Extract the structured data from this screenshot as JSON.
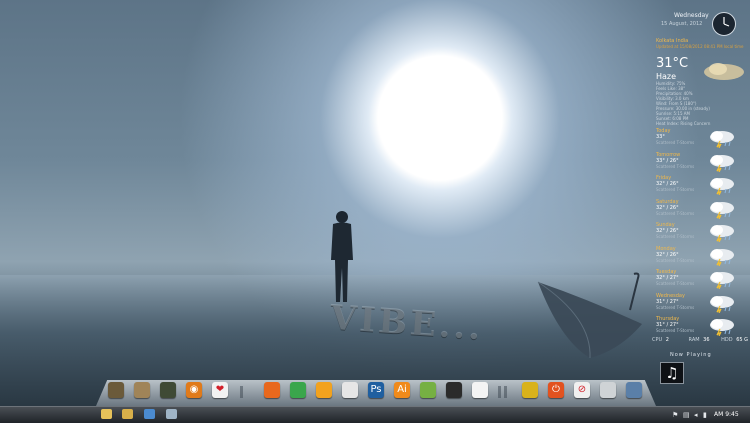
{
  "wallpaper": {
    "engraved_text": "VIBE..."
  },
  "clock_widget": {
    "day": "Wednesday",
    "date": "15 August, 2012"
  },
  "weather": {
    "location": "Kolkata India",
    "updated": "Updated at 15/08/2012 08:41 PM local time",
    "temperature": "31°C",
    "condition": "Haze",
    "details": [
      "Humidity: 75%",
      "Feels Like: 38°",
      "Precipitation: 40%",
      "Visibility: 3.0 km",
      "Wind: From S (180°)",
      "Pressure: 30.00 in (steady)",
      "Sunrise: 5:15 AM",
      "Sunset: 6:08 PM",
      "Heat Index: Rising Concern"
    ],
    "forecast": [
      {
        "day": "Today",
        "temp": "33°",
        "desc": "Scattered T-Storms"
      },
      {
        "day": "Tomorrow",
        "temp": "33° / 26°",
        "desc": "Scattered T-Storms"
      },
      {
        "day": "Friday",
        "temp": "32° / 26°",
        "desc": "Scattered T-Storms"
      },
      {
        "day": "Saturday",
        "temp": "32° / 26°",
        "desc": "Scattered T-Storms"
      },
      {
        "day": "Sunday",
        "temp": "32° / 26°",
        "desc": "Scattered T-Storms"
      },
      {
        "day": "Monday",
        "temp": "32° / 26°",
        "desc": "Scattered T-Storms"
      },
      {
        "day": "Tuesday",
        "temp": "32° / 27°",
        "desc": "Scattered T-Storms"
      },
      {
        "day": "Wednesday",
        "temp": "31° / 27°",
        "desc": "Scattered T-Storms"
      },
      {
        "day": "Thursday",
        "temp": "31° / 27°",
        "desc": "Scattered T-Storms"
      }
    ]
  },
  "system": {
    "cpu_label": "CPU",
    "cpu_value": "2",
    "ram_label": "RAM",
    "ram_value": "36",
    "hdd_label": "HDD",
    "hdd_value": "65 G"
  },
  "now_playing": {
    "label": "Now Playing",
    "icon": "music-note-icon"
  },
  "dock": {
    "icons": [
      {
        "name": "computer-icon",
        "color": "#6b5a3a"
      },
      {
        "name": "folder-icon",
        "color": "#a08458"
      },
      {
        "name": "movie-icon",
        "color": "#3f4a35"
      },
      {
        "name": "speaker-icon",
        "color": "#e07a1a"
      },
      {
        "name": "heart-icon",
        "color": "#f2f2f2"
      },
      {
        "name": "firefox-icon",
        "color": "#e8681d"
      },
      {
        "name": "chrome-icon",
        "color": "#3aa64c"
      },
      {
        "name": "media-player-icon",
        "color": "#f2a21e"
      },
      {
        "name": "itunes-icon",
        "color": "#e6e6e6"
      },
      {
        "name": "photoshop-icon",
        "color": "#1f5fa0"
      },
      {
        "name": "illustrator-icon",
        "color": "#f08a1a"
      },
      {
        "name": "utorrent-icon",
        "color": "#76b043"
      },
      {
        "name": "gamepad-icon",
        "color": "#2b2b2b"
      },
      {
        "name": "blank-app-icon",
        "color": "#f4f4f4"
      },
      {
        "name": "control-panel-icon",
        "color": "#d9b21c"
      },
      {
        "name": "power-icon",
        "color": "#e2521f"
      },
      {
        "name": "no-entry-icon",
        "color": "#f0f0f0"
      },
      {
        "name": "recycle-bin-icon",
        "color": "#cfd3d6"
      },
      {
        "name": "network-icon",
        "color": "#5a7fa8"
      }
    ],
    "glyphs": {
      "speaker-icon": "◉",
      "heart-icon": "❤",
      "photoshop-icon": "Ps",
      "illustrator-icon": "Ai",
      "power-icon": "⏻",
      "no-entry-icon": "⊘"
    }
  },
  "taskbar": {
    "time": "AM 9:45",
    "pinned": [
      {
        "name": "explorer-icon",
        "color": "#e6c25a"
      },
      {
        "name": "media-icon",
        "color": "#d8b04a"
      },
      {
        "name": "network-app-icon",
        "color": "#4b8bd0"
      },
      {
        "name": "tools-icon",
        "color": "#9fb4c6"
      }
    ]
  }
}
